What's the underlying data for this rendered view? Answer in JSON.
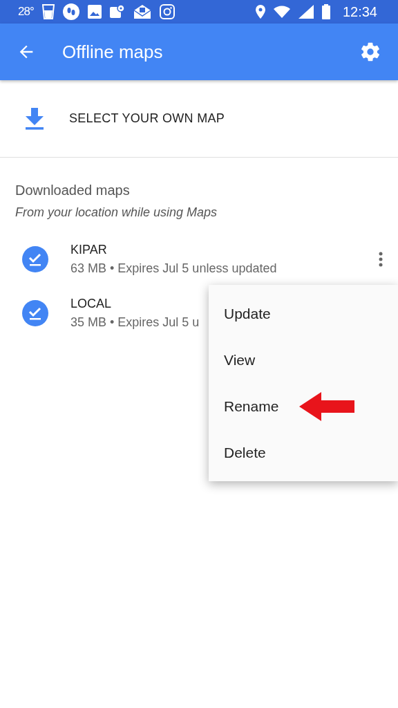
{
  "status_bar": {
    "temperature": "28°",
    "time": "12:34"
  },
  "app_bar": {
    "title": "Offline maps"
  },
  "select_action": {
    "label": "SELECT YOUR OWN MAP"
  },
  "section": {
    "title": "Downloaded maps",
    "subtitle": "From your location while using Maps"
  },
  "maps": [
    {
      "name": "KIPAR",
      "details": "63 MB • Expires Jul 5 unless updated",
      "more_button": true
    },
    {
      "name": "LOCAL",
      "details": "35 MB • Expires Jul 5 u",
      "more_button": false
    }
  ],
  "menu": {
    "items": [
      {
        "label": "Update",
        "pointed": false
      },
      {
        "label": "View",
        "pointed": false
      },
      {
        "label": "Rename",
        "pointed": true
      },
      {
        "label": "Delete",
        "pointed": false
      }
    ]
  }
}
